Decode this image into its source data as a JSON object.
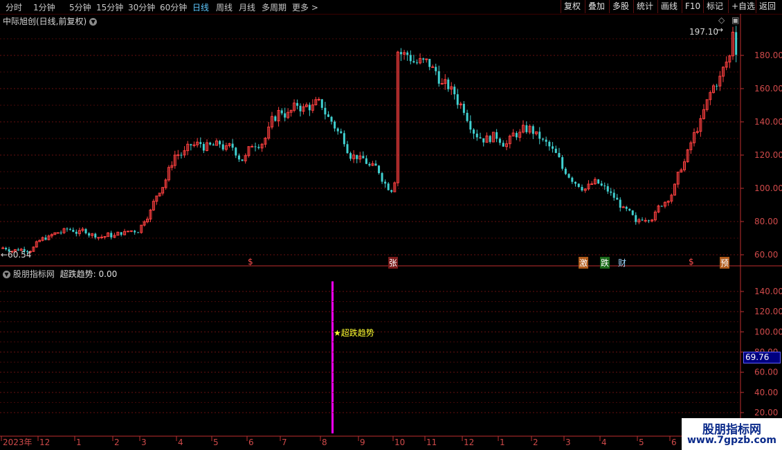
{
  "toolbar": {
    "tabs": [
      "分时",
      "1分钟",
      "5分钟",
      "15分钟",
      "30分钟",
      "60分钟",
      "日线",
      "周线",
      "月线",
      "多周期",
      "更多 >"
    ],
    "active_tab": "日线",
    "right_buttons": [
      "复权",
      "叠加",
      "多股",
      "统计",
      "画线",
      "F10",
      "+自选",
      "返回"
    ]
  },
  "main_panel": {
    "title": "中际旭创(日线,前复权)",
    "high_label": "197.10",
    "low_label": "←60.54",
    "y_axis": [
      60,
      80,
      100,
      120,
      140,
      160,
      180
    ],
    "y_axis_labels": [
      "60.00",
      "80.00",
      "100.00",
      "120.00",
      "140.00",
      "160.00",
      "180.00"
    ],
    "markers": [
      {
        "text": "$",
        "color": "#ff5050",
        "bg": "",
        "x_month": "6"
      },
      {
        "text": "张",
        "color": "#ffffff",
        "bg": "#7a1a1a",
        "x_month": "10"
      },
      {
        "text": "激",
        "color": "#ffffff",
        "bg": "#b05a1a",
        "x_month": "3b"
      },
      {
        "text": "跌",
        "color": "#ffffff",
        "bg": "#1a6a1a",
        "x_month": "4a"
      },
      {
        "text": "财",
        "color": "#9fd8ff",
        "bg": "",
        "x_month": "4b"
      },
      {
        "text": "$",
        "color": "#ff5050",
        "bg": "",
        "x_month": "5b"
      },
      {
        "text": "预",
        "color": "#ffffff",
        "bg": "#b05a1a",
        "x_month": "6b"
      }
    ]
  },
  "indicator_panel": {
    "title": "股朋指标网",
    "value_label": "超跌趋势: 0.00",
    "signal_label": "★超跌趋势",
    "y_axis_labels": [
      "20.00",
      "40.00",
      "60.00",
      "80.00",
      "100.00",
      "120.00",
      "140.00"
    ],
    "y_axis": [
      20,
      40,
      60,
      80,
      100,
      120,
      140
    ],
    "current_value": "69.76",
    "colors": {
      "signal_bar": "#ff00ff",
      "value_box": "#000080"
    }
  },
  "time_axis": {
    "labels": [
      "2023年",
      "12",
      "1",
      "2",
      "3",
      "4",
      "5",
      "6",
      "7",
      "8",
      "9",
      "10",
      "11",
      "12",
      "1",
      "2",
      "3",
      "4",
      "5",
      "6"
    ]
  },
  "watermark": {
    "title": "股朋指标网",
    "url": "www.7gpzb.com"
  },
  "chart_data": {
    "type": "candlestick",
    "title": "中际旭创(日线,前复权)",
    "period": "daily",
    "x": [
      "2023-11",
      "2023-12",
      "2024-01",
      "2024-02",
      "2024-03",
      "2024-04",
      "2024-05",
      "2024-06",
      "2024-07",
      "2024-08",
      "2024-09",
      "2024-10",
      "2024-11",
      "2024-12",
      "2025-01",
      "2025-02",
      "2025-03",
      "2025-04",
      "2025-05",
      "2025-06"
    ],
    "approx_close": [
      66,
      75,
      72,
      75,
      120,
      125,
      118,
      145,
      150,
      120,
      100,
      175,
      150,
      132,
      135,
      112,
      103,
      78,
      95,
      185
    ],
    "high": 197.1,
    "low": 60.54,
    "ylim": [
      55,
      200
    ],
    "indicator": {
      "name": "超跌趋势",
      "value": 0.0,
      "signal_month": "2024-08",
      "signal_value": 150,
      "ylim": [
        0,
        150
      ]
    }
  }
}
